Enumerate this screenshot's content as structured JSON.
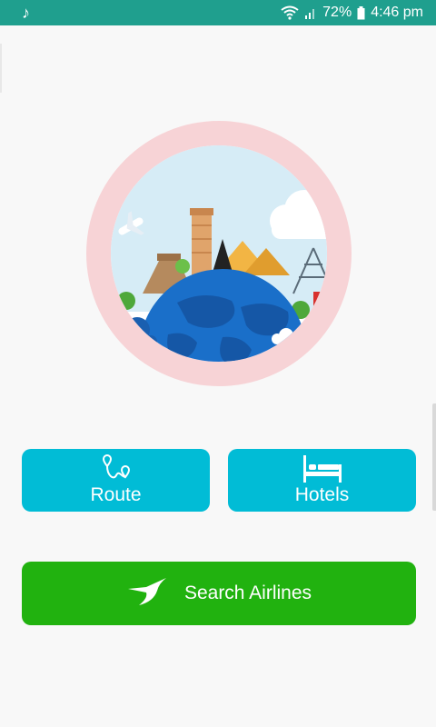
{
  "status_bar": {
    "battery_percent": "72%",
    "time": "4:46 pm",
    "icons": [
      "music-note-icon",
      "wifi-icon",
      "signal-icon",
      "battery-icon"
    ]
  },
  "hero": {
    "image": "travel-landmarks-globe-illustration"
  },
  "buttons": {
    "route": {
      "label": "Route",
      "icon": "route-pins-icon"
    },
    "hotels": {
      "label": "Hotels",
      "icon": "bed-icon"
    },
    "airlines": {
      "label": "Search Airlines",
      "icon": "airline-bird-logo-icon"
    }
  },
  "colors": {
    "status_bar": "#1f9f8e",
    "primary_button": "#01bcd6",
    "airlines_button": "#21b20f",
    "ring": "#f7d3d6",
    "sky": "#d6ecf6",
    "globe": "#1a6fc9"
  }
}
